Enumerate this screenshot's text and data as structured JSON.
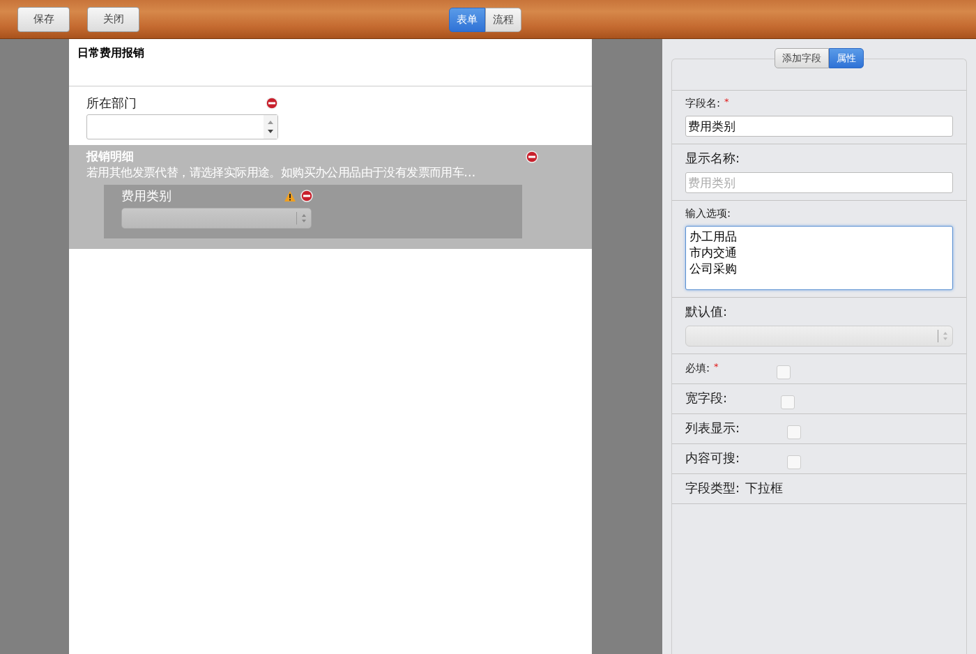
{
  "toolbar": {
    "buttons": [
      "保存",
      "关闭"
    ],
    "view_tabs": [
      {
        "label": "表单",
        "selected": true
      },
      {
        "label": "流程",
        "selected": false
      }
    ]
  },
  "form": {
    "title": "日常费用报销",
    "fields": [
      {
        "kind": "spinner",
        "label": "所在部门",
        "warning": false
      }
    ],
    "section": {
      "title": "报销明细",
      "description": "若用其他发票代替，请选择实际用途。如购买办公用品由于没有发票而用车…",
      "fields": [
        {
          "kind": "select",
          "label": "费用类别",
          "warning": true
        }
      ]
    }
  },
  "panel": {
    "tabs": [
      {
        "label": "添加字段",
        "selected": false
      },
      {
        "label": "属性",
        "selected": true
      }
    ],
    "rows": [
      {
        "kind": "text",
        "label": "字段名:",
        "required_mark": "*",
        "value": "费用类别"
      },
      {
        "kind": "text",
        "label": "显示名称:",
        "placeholder": "费用类别"
      },
      {
        "kind": "textarea",
        "label": "输入选项:",
        "lines": [
          "办工用品",
          "市内交通",
          "公司采购"
        ]
      },
      {
        "kind": "select",
        "label": "默认值:"
      },
      {
        "kind": "checkbox",
        "label": "必填:",
        "required_mark": "*",
        "checked": false
      },
      {
        "kind": "checkbox",
        "label": "宽字段:",
        "checked": false
      },
      {
        "kind": "checkbox",
        "label": "列表显示:",
        "checked": false
      },
      {
        "kind": "checkbox",
        "label": "内容可搜:",
        "checked": false
      },
      {
        "kind": "info",
        "label": "字段类型:",
        "value": "下拉框"
      }
    ]
  }
}
